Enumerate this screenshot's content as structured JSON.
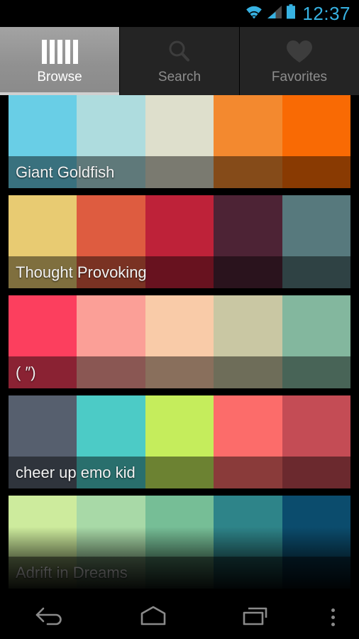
{
  "statusbar": {
    "time": "12:37",
    "time_color": "#37b2e2",
    "icons": [
      {
        "name": "wifi-icon",
        "label": "wifi"
      },
      {
        "name": "cellular-signal-icon",
        "label": "signal"
      },
      {
        "name": "battery-icon",
        "label": "battery"
      }
    ]
  },
  "tabs": [
    {
      "label": "Browse",
      "icon": "palette-bars-icon",
      "active": true
    },
    {
      "label": "Search",
      "icon": "search-icon",
      "active": false
    },
    {
      "label": "Favorites",
      "icon": "heart-icon",
      "active": false
    }
  ],
  "palettes": [
    {
      "name": "Giant Goldfish",
      "colors": [
        "#69CEE6",
        "#AEDCDE",
        "#DEDFCC",
        "#F3892F",
        "#F96A04"
      ]
    },
    {
      "name": "Thought Provoking",
      "colors": [
        "#E8CB72",
        "#DE5C40",
        "#BE2239",
        "#4D2335",
        "#57797D"
      ]
    },
    {
      "name": "( ″)",
      "colors": [
        "#FC3F5E",
        "#FB9F97",
        "#F9CBA8",
        "#C9C7A3",
        "#83B79E"
      ]
    },
    {
      "name": "cheer up emo kid",
      "colors": [
        "#565F6E",
        "#4CCBC6",
        "#C5ED5C",
        "#FC6C6A",
        "#C44C55"
      ]
    },
    {
      "name": "Adrift in Dreams",
      "colors": [
        "#CDEB9D",
        "#A8D9A7",
        "#76BE96",
        "#2E8489",
        "#0B4C6D"
      ]
    }
  ],
  "navbar": {
    "buttons": [
      {
        "name": "back-button",
        "label": "Back"
      },
      {
        "name": "home-button",
        "label": "Home"
      },
      {
        "name": "recents-button",
        "label": "Recent apps"
      },
      {
        "name": "overflow-button",
        "label": "More options"
      }
    ]
  }
}
